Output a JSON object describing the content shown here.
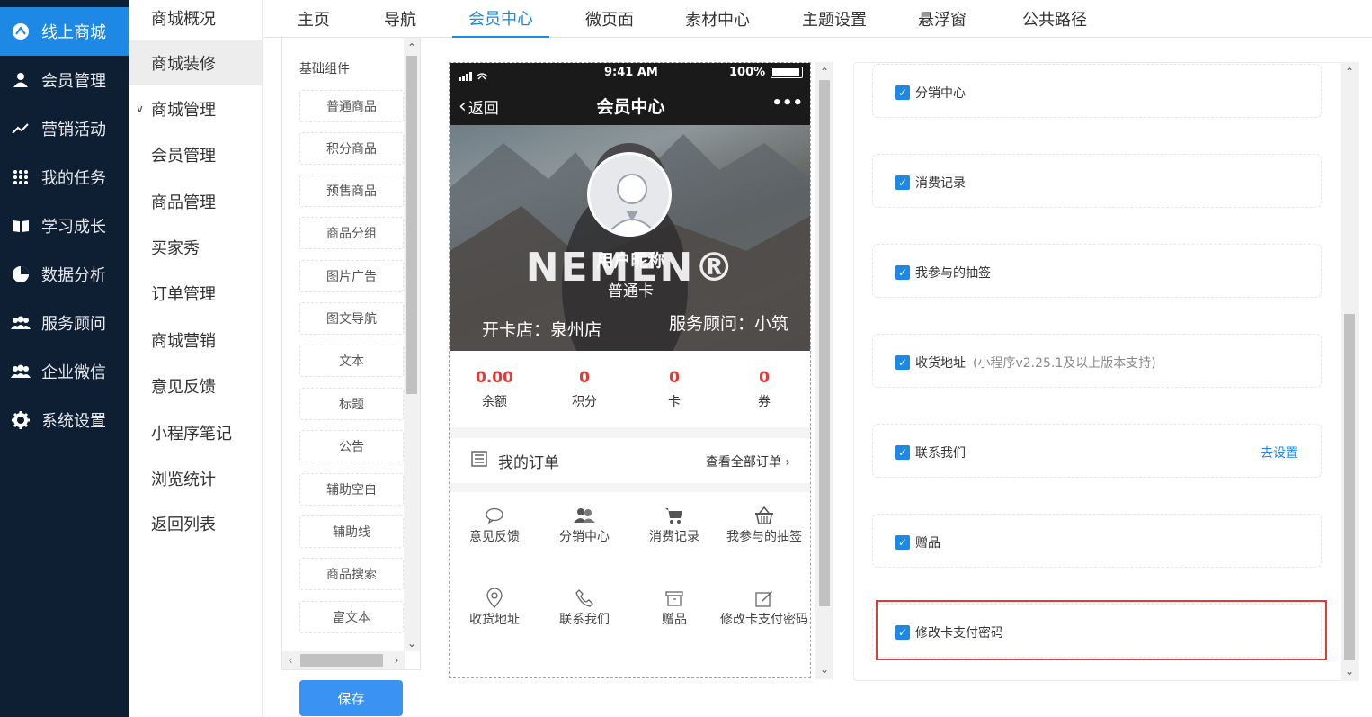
{
  "nav": {
    "items": [
      {
        "label": "线上商城",
        "icon": "store-icon",
        "glyph": "⊕"
      },
      {
        "label": "会员管理",
        "icon": "user-icon",
        "glyph": "●"
      },
      {
        "label": "营销活动",
        "icon": "trend-icon",
        "glyph": "↗"
      },
      {
        "label": "我的任务",
        "icon": "grid-icon",
        "glyph": "⠿"
      },
      {
        "label": "学习成长",
        "icon": "book-icon",
        "glyph": "▤"
      },
      {
        "label": "数据分析",
        "icon": "pie-chart-icon",
        "glyph": "◔"
      },
      {
        "label": "服务顾问",
        "icon": "team-icon",
        "glyph": "⚉"
      },
      {
        "label": "企业微信",
        "icon": "wecom-icon",
        "glyph": "⚉"
      },
      {
        "label": "系统设置",
        "icon": "gear-icon",
        "glyph": "⚙"
      }
    ]
  },
  "subnav": {
    "items": [
      "商城概况",
      "商城装修",
      "商城管理",
      "会员管理",
      "商品管理",
      "买家秀",
      "订单管理",
      "商城营销",
      "意见反馈",
      "小程序笔记",
      "浏览统计",
      "返回列表"
    ]
  },
  "tabs": [
    "主页",
    "导航",
    "会员中心",
    "微页面",
    "素材中心",
    "主题设置",
    "悬浮窗",
    "公共路径"
  ],
  "components": {
    "title": "基础组件",
    "items": [
      "普通商品",
      "积分商品",
      "预售商品",
      "商品分组",
      "图片广告",
      "图文导航",
      "文本",
      "标题",
      "公告",
      "辅助空白",
      "辅助线",
      "商品搜索",
      "富文本"
    ]
  },
  "save_label": "保存",
  "phone": {
    "time": "9:41 AM",
    "battery": "100%",
    "back_label": "返回",
    "title": "会员中心",
    "more": "•••",
    "brand_text": "NEMEN®",
    "nickname": "用户昵称",
    "card_type": "普通卡",
    "store": "开卡店：泉州店",
    "advisor": "服务顾问：小筑",
    "stats": [
      {
        "num": "0.00",
        "label": "余额"
      },
      {
        "num": "0",
        "label": "积分"
      },
      {
        "num": "0",
        "label": "卡"
      },
      {
        "num": "0",
        "label": "券"
      }
    ],
    "orders_label": "我的订单",
    "all_orders_label": "查看全部订单 ›",
    "grid": [
      {
        "label": "意见反馈",
        "icon": "chat-icon",
        "glyph": "◯"
      },
      {
        "label": "分销中心",
        "icon": "people-icon",
        "glyph": "⚇"
      },
      {
        "label": "消费记录",
        "icon": "cart-icon",
        "glyph": "⛟"
      },
      {
        "label": "我参与的抽签",
        "icon": "basket-icon",
        "glyph": "⌸"
      },
      {
        "label": "收货地址",
        "icon": "location-icon",
        "glyph": "⌾"
      },
      {
        "label": "联系我们",
        "icon": "phone-icon",
        "glyph": "✆"
      },
      {
        "label": "赠品",
        "icon": "box-icon",
        "glyph": "▭"
      },
      {
        "label": "修改卡支付密码",
        "icon": "edit-icon",
        "glyph": "✎"
      }
    ]
  },
  "settings": {
    "cards": [
      {
        "label": "分销中心",
        "hint": "",
        "link": ""
      },
      {
        "label": "消费记录",
        "hint": "",
        "link": ""
      },
      {
        "label": "我参与的抽签",
        "hint": "",
        "link": ""
      },
      {
        "label": "收货地址",
        "hint": "(小程序v2.25.1及以上版本支持)",
        "link": ""
      },
      {
        "label": "联系我们",
        "hint": "",
        "link": "去设置"
      },
      {
        "label": "赠品",
        "hint": "",
        "link": ""
      },
      {
        "label": "修改卡支付密码",
        "hint": "",
        "link": ""
      }
    ]
  },
  "colors": {
    "accent": "#1e88e5",
    "nav_bg": "#0f1f33",
    "highlight": "#e53935",
    "stat_red": "#e53935"
  }
}
